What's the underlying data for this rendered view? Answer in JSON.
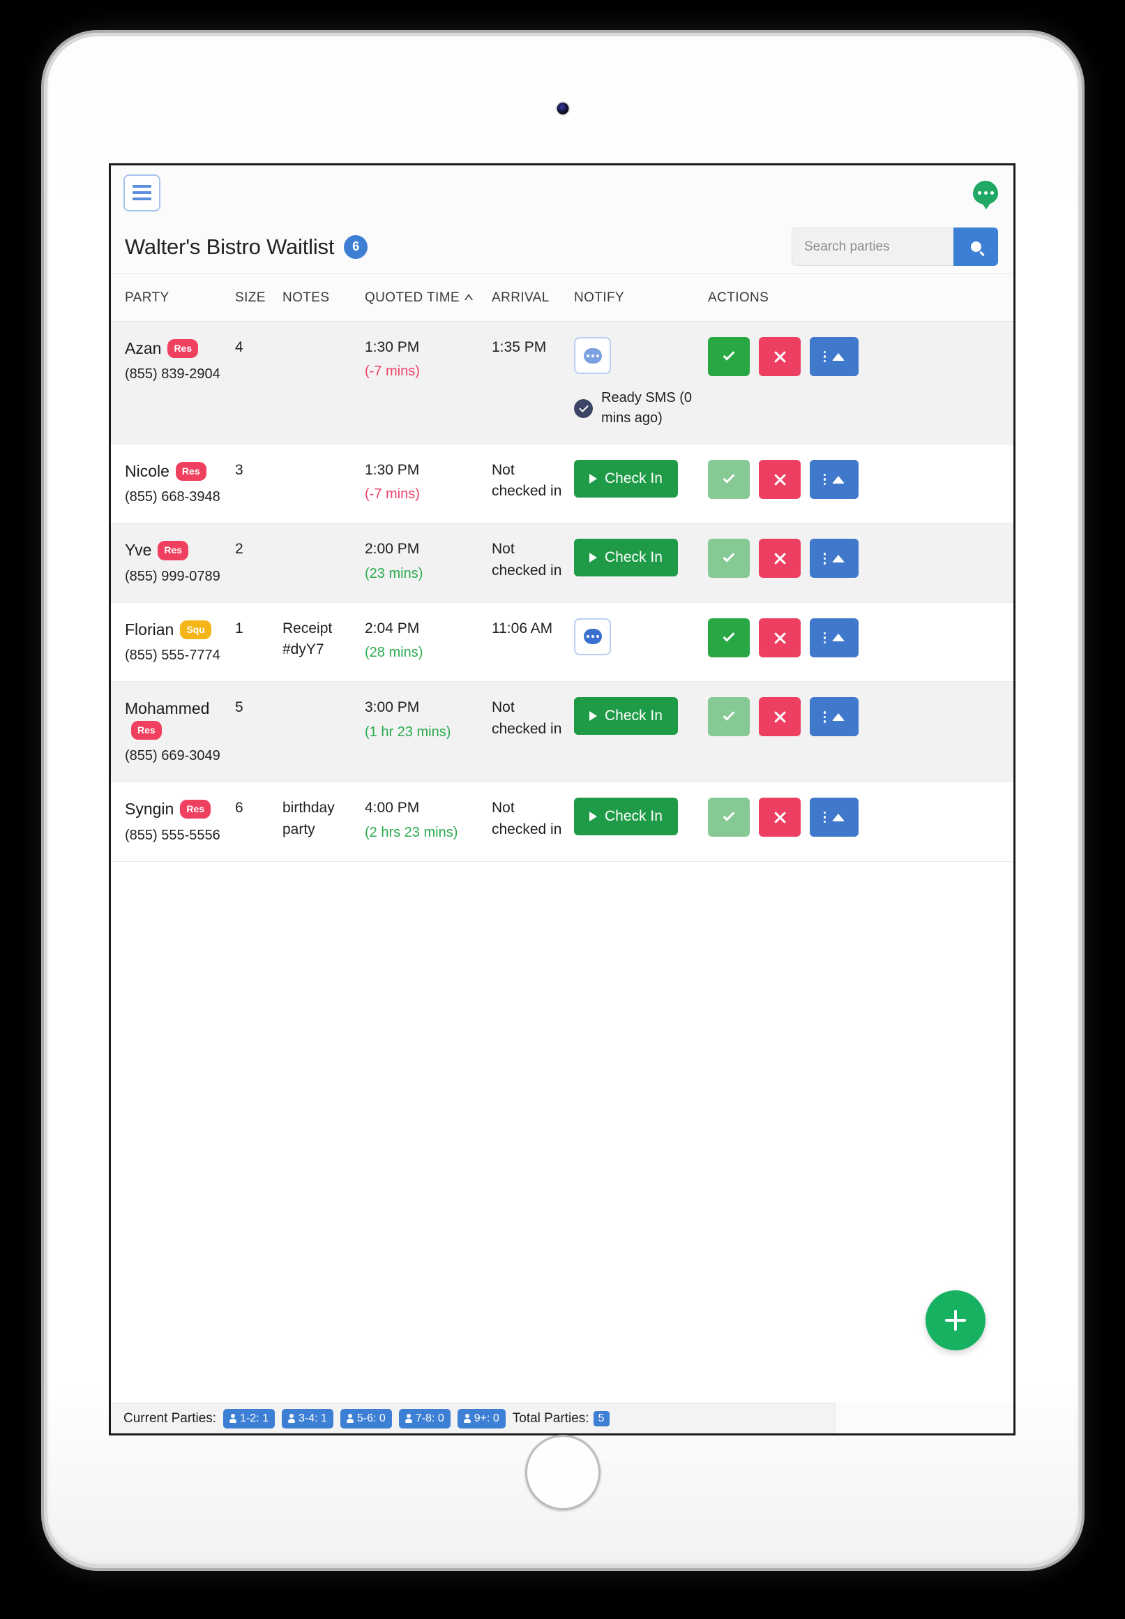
{
  "topbar": {
    "menu_icon": "hamburger-icon",
    "chat_icon": "chat-bubble-icon"
  },
  "header": {
    "title": "Walter's Bistro Waitlist",
    "count": "6"
  },
  "search": {
    "placeholder": "Search parties",
    "value": "",
    "button_icon": "search-icon"
  },
  "table": {
    "columns": [
      "PARTY",
      "SIZE",
      "NOTES",
      "QUOTED TIME",
      "ARRIVAL",
      "NOTIFY",
      "ACTIONS"
    ],
    "sort_column": "QUOTED TIME",
    "sort_direction": "asc",
    "rows": [
      {
        "name": "Azan",
        "badge": "Res",
        "badge_type": "res",
        "phone": "(855) 839-2904",
        "size": "4",
        "notes": "",
        "quoted_time": "1:30 PM",
        "quoted_delta": "(-7 mins)",
        "delta_state": "late",
        "arrival": "1:35 PM",
        "notify_type": "icon",
        "notify_icon": "chat-bubble-icon",
        "sms_status": "Ready SMS  (0 mins ago)",
        "checkin_label": "",
        "confirm_enabled": true
      },
      {
        "name": "Nicole",
        "badge": "Res",
        "badge_type": "res",
        "phone": "(855) 668-3948",
        "size": "3",
        "notes": "",
        "quoted_time": "1:30 PM",
        "quoted_delta": "(-7 mins)",
        "delta_state": "late",
        "arrival": "Not checked in",
        "notify_type": "checkin",
        "notify_icon": "",
        "sms_status": "",
        "checkin_label": "Check In",
        "confirm_enabled": false
      },
      {
        "name": "Yve",
        "badge": "Res",
        "badge_type": "res",
        "phone": "(855) 999-0789",
        "size": "2",
        "notes": "",
        "quoted_time": "2:00 PM",
        "quoted_delta": "(23 mins)",
        "delta_state": "ok",
        "arrival": "Not checked in",
        "notify_type": "checkin",
        "notify_icon": "",
        "sms_status": "",
        "checkin_label": "Check In",
        "confirm_enabled": false
      },
      {
        "name": "Florian",
        "badge": "Squ",
        "badge_type": "squ",
        "phone": "(855) 555-7774",
        "size": "1",
        "notes": "Receipt #dyY7",
        "quoted_time": "2:04 PM",
        "quoted_delta": "(28 mins)",
        "delta_state": "ok",
        "arrival": "11:06 AM",
        "notify_type": "icon",
        "notify_icon": "chat-bubble-icon",
        "sms_status": "",
        "checkin_label": "",
        "confirm_enabled": true
      },
      {
        "name": "Mohammed",
        "badge": "Res",
        "badge_type": "res",
        "phone": "(855) 669-3049",
        "size": "5",
        "notes": "",
        "quoted_time": "3:00 PM",
        "quoted_delta": "(1 hr 23 mins)",
        "delta_state": "ok",
        "arrival": "Not checked in",
        "notify_type": "checkin",
        "notify_icon": "",
        "sms_status": "",
        "checkin_label": "Check In",
        "confirm_enabled": false
      },
      {
        "name": "Syngin",
        "badge": "Res",
        "badge_type": "res",
        "phone": "(855) 555-5556",
        "size": "6",
        "notes": "birthday party",
        "quoted_time": "4:00 PM",
        "quoted_delta": "(2 hrs 23 mins)",
        "delta_state": "ok",
        "arrival": "Not checked in",
        "notify_type": "checkin",
        "notify_icon": "",
        "sms_status": "",
        "checkin_label": "Check In",
        "confirm_enabled": false
      }
    ]
  },
  "fab": {
    "icon": "plus-icon"
  },
  "footer": {
    "current_label": "Current Parties:",
    "chips": [
      "1-2: 1",
      "3-4: 1",
      "5-6: 0",
      "7-8: 0",
      "9+: 0"
    ],
    "total_label": "Total Parties:",
    "total_value": "5"
  },
  "colors": {
    "accent_blue": "#3d7fd4",
    "green": "#1f9b47",
    "red": "#ec3f62",
    "badge_res": "#ef4060",
    "badge_squ": "#f5b518",
    "fab_green": "#17b162"
  }
}
